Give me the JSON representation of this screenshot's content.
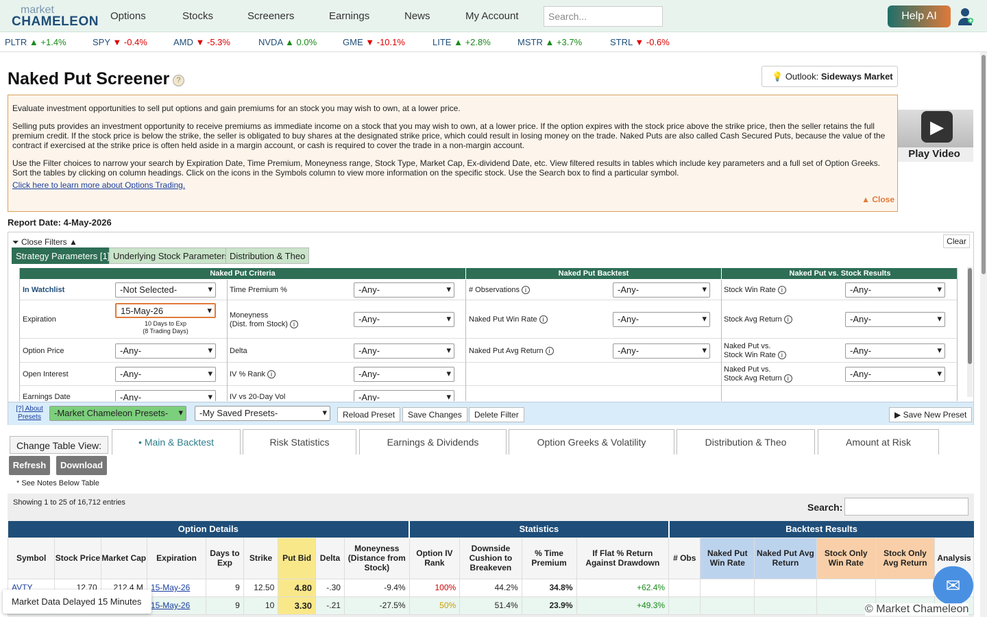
{
  "logo": {
    "line1": "market",
    "line2": "CHAMELEON"
  },
  "nav": [
    "Options",
    "Stocks",
    "Screeners",
    "Earnings",
    "News",
    "My Account"
  ],
  "search_placeholder": "Search...",
  "help_ai": "Help AI",
  "ticker": [
    {
      "sym": "PLTR",
      "arrow": "▲",
      "chg": "+1.4%",
      "dir": "up"
    },
    {
      "sym": "SPY",
      "arrow": "▼",
      "chg": "-0.4%",
      "dir": "dn"
    },
    {
      "sym": "AMD",
      "arrow": "▼",
      "chg": "-5.3%",
      "dir": "dn"
    },
    {
      "sym": "NVDA",
      "arrow": "▲",
      "chg": "0.0%",
      "dir": "up"
    },
    {
      "sym": "GME",
      "arrow": "▼",
      "chg": "-10.1%",
      "dir": "dn"
    },
    {
      "sym": "LITE",
      "arrow": "▲",
      "chg": "+2.8%",
      "dir": "up"
    },
    {
      "sym": "MSTR",
      "arrow": "▲",
      "chg": "+3.7%",
      "dir": "up"
    },
    {
      "sym": "STRL",
      "arrow": "▼",
      "chg": "-0.6%",
      "dir": "dn"
    }
  ],
  "title": "Naked Put Screener",
  "outlook": {
    "label": "Outlook:",
    "value": "Sideways Market"
  },
  "desc": {
    "p1": "Evaluate investment opportunities to sell put options and gain premiums for an stock you may wish to own, at a lower price.",
    "p2": "Selling puts provides an investment opportunity to receive premiums as immediate income on a stock that you may wish to own, at a lower price. If the option expires with the stock price above the strike price, then the seller retains the full premium credit. If the stock price is below the strike, the seller is obligated to buy shares at the designated strike price, which could result in losing money on the trade. Naked Puts are also called Cash Secured Puts, because the value of the contract if exercised at the strike price is often held aside in a margin account, or cash is required to cover the trade in a non-margin account.",
    "p3": "Use the Filter choices to narrow your search by Expiration Date, Time Premium, Moneyness range, Stock Type, Market Cap, Ex-dividend Date, etc. View filtered results in tables which include key parameters and a full set of Option Greeks. Sort the tables by clicking on column headings. Click on the icons in the Symbols column to view more information on the specific stock. Use the Search box to find a particular symbol.",
    "link": "Click here to learn more about Options Trading.",
    "close": "▲ Close"
  },
  "video_label": "Play Video",
  "report_date": "Report Date: 4-May-2026",
  "filters": {
    "close": "Close Filters ▲",
    "clear": "Clear",
    "tabs": [
      "Strategy Parameters [1]",
      "Underlying Stock Parameters",
      "Distribution & Theo"
    ],
    "headers": [
      "Naked Put Criteria",
      "Naked Put Backtest",
      "Naked Put vs. Stock Results"
    ],
    "any": "-Any-",
    "watchlist_label": "In Watchlist",
    "watchlist_val": "-Not Selected-",
    "expiration_label": "Expiration",
    "expiration_val": "15-May-26",
    "exp_note1": "10 Days to Exp",
    "exp_note2": "(8 Trading Days)",
    "option_price": "Option Price",
    "open_interest": "Open Interest",
    "earnings_date": "Earnings Date",
    "time_premium": "Time Premium %",
    "moneyness1": "Moneyness",
    "moneyness2": "(Dist. from Stock)",
    "delta": "Delta",
    "ivrank": "IV % Rank",
    "iv20": "IV vs 20-Day Vol",
    "observations": "# Observations",
    "np_win_rate": "Naked Put Win Rate",
    "np_avg_return": "Naked Put Avg Return",
    "stock_win_rate": "Stock Win Rate",
    "stock_avg_return": "Stock Avg Return",
    "npvs1": "Naked Put vs.",
    "npvs_win": "Stock Win Rate",
    "npvs_avg": "Stock Avg Return",
    "about_presets": "[?] About Presets",
    "mc_presets": "-Market Chameleon Presets-",
    "my_presets": "-My Saved Presets-",
    "reload": "Reload Preset",
    "save": "Save Changes",
    "delete": "Delete Filter",
    "save_new": "Save New Preset"
  },
  "view": {
    "label": "Change Table View:",
    "tabs": [
      "Main & Backtest",
      "Risk Statistics",
      "Earnings & Dividends",
      "Option Greeks & Volatility",
      "Distribution & Theo",
      "Amount at Risk"
    ]
  },
  "refresh": "Refresh",
  "download": "Download",
  "notes": "* See Notes Below Table",
  "showing": "Showing 1 to 25 of 16,712 entries",
  "search_label": "Search:",
  "groups": [
    "Option Details",
    "Statistics",
    "Backtest Results"
  ],
  "columns": [
    "Symbol",
    "Stock Price",
    "Market Cap",
    "Expiration",
    "Days to Exp",
    "Strike",
    "Put Bid",
    "Delta",
    "Moneyness (Distance from Stock)",
    "Option IV Rank",
    "Downside Cushion to Breakeven",
    "% Time Premium",
    "If Flat % Return Against Drawdown",
    "# Obs",
    "Naked Put Win Rate",
    "Naked Put Avg Return",
    "Stock Only Win Rate",
    "Stock Only Avg Return",
    "Analysis"
  ],
  "rows": [
    [
      "AVTY",
      "12.70",
      "212.4 M",
      "15-May-26",
      "9",
      "12.50",
      "4.80",
      "-.30",
      "-9.4%",
      "100%",
      "44.2%",
      "34.8%",
      "+62.4%",
      "",
      "",
      "",
      "",
      "",
      ""
    ],
    [
      "",
      "",
      "",
      "15-May-26",
      "9",
      "10",
      "3.30",
      "-.21",
      "-27.5%",
      "50%",
      "51.4%",
      "23.9%",
      "+49.3%",
      "",
      "",
      "",
      "",
      "",
      ""
    ]
  ],
  "delayed": "Market Data Delayed 15 Minutes",
  "copyright": "© Market Chameleon"
}
